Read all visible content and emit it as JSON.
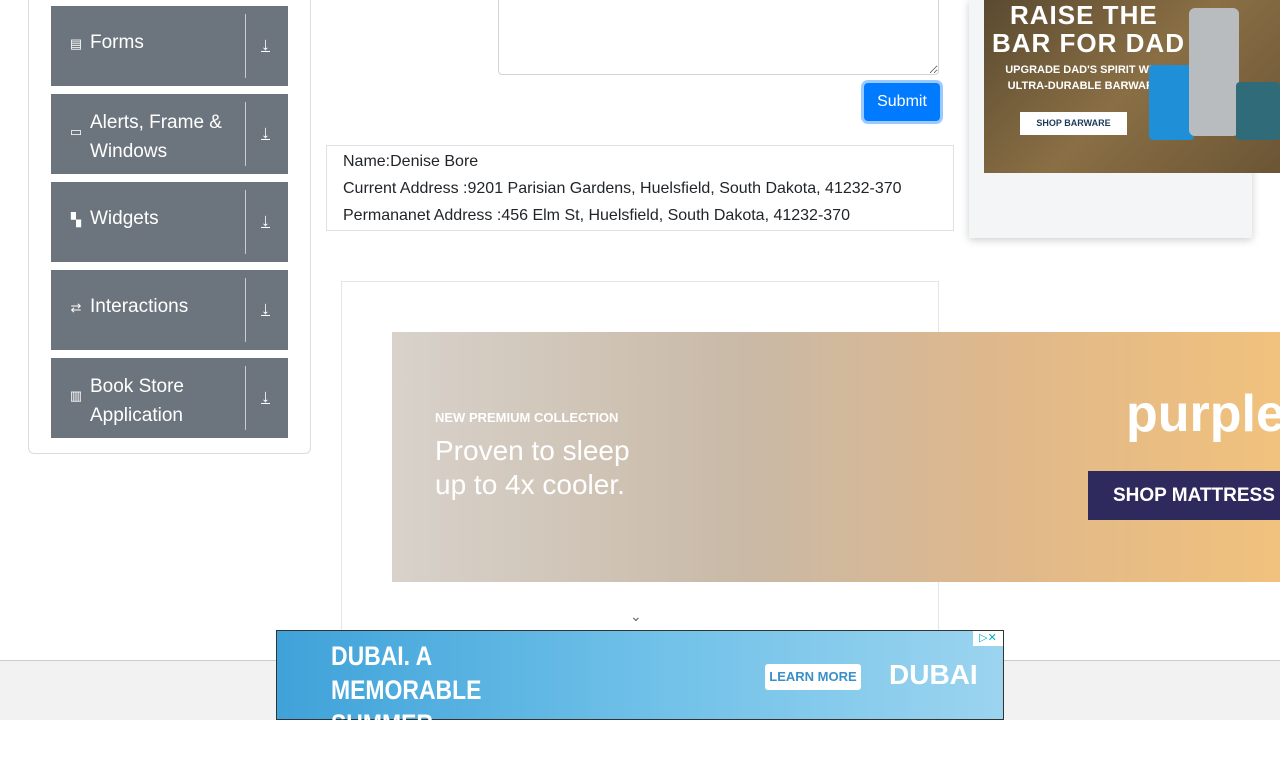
{
  "sidebar": {
    "groups": [
      {
        "label": "Forms",
        "icon": "form-icon"
      },
      {
        "label": "Alerts, Frame & Windows",
        "icon": "window-icon"
      },
      {
        "label": "Widgets",
        "icon": "widgets-icon"
      },
      {
        "label": "Interactions",
        "icon": "interactions-icon"
      },
      {
        "label": "Book Store Application",
        "icon": "books-icon"
      }
    ]
  },
  "form": {
    "submit_label": "Submit"
  },
  "output": {
    "name": "Name:Denise Bore",
    "current_address": "Current Address :9201 Parisian Gardens, Huelsfield, South Dakota, 41232-370",
    "permanent_address": "Permananet Address :456 Elm St, Huelsfield, South Dakota, 41232-370"
  },
  "ads": {
    "yeti": {
      "line1": "RAISE THE",
      "line2": "BAR FOR DAD",
      "line3": "UPGRADE DAD'S SPIRIT WITH ULTRA-DURABLE BARWARE.",
      "cta": "SHOP BARWARE"
    },
    "purple": {
      "kicker": "NEW PREMIUM COLLECTION",
      "headline": "Proven to sleep up to 4x cooler.",
      "brand": "purple",
      "cta": "SHOP MATTRESS"
    },
    "dubai": {
      "headline": "DUBAI. A MEMORABLE SUMMER VACATION",
      "cta": "LEARN MORE",
      "brand": "DUBAI"
    }
  }
}
